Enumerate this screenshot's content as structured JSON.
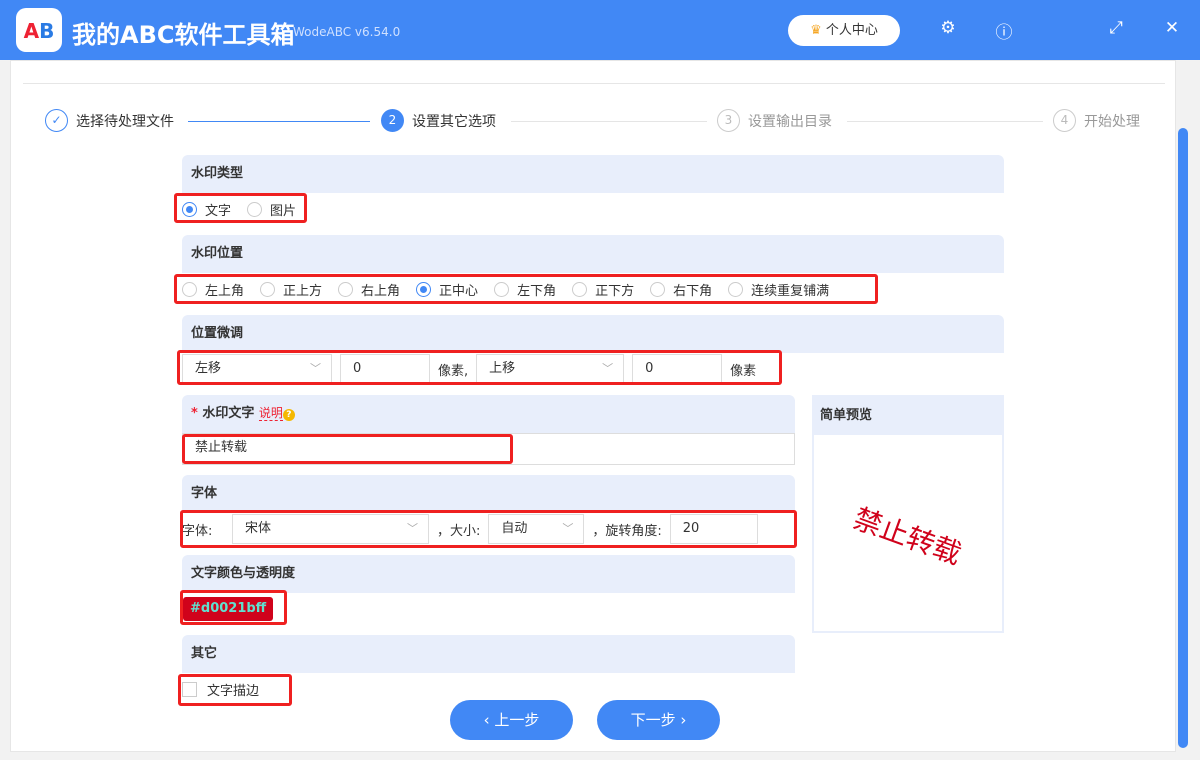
{
  "app": {
    "title": "我的ABC软件工具箱",
    "version": "WodeABC v6.54.0",
    "logo_text": "AB",
    "user_center": "个人中心"
  },
  "steps": [
    {
      "num": "✓",
      "label": "选择待处理文件"
    },
    {
      "num": "2",
      "label": "设置其它选项"
    },
    {
      "num": "3",
      "label": "设置输出目录"
    },
    {
      "num": "4",
      "label": "开始处理"
    }
  ],
  "watermark_type": {
    "title": "水印类型",
    "options": [
      "文字",
      "图片"
    ],
    "selected": "文字"
  },
  "watermark_position": {
    "title": "水印位置",
    "options": [
      "左上角",
      "正上方",
      "右上角",
      "正中心",
      "左下角",
      "正下方",
      "右下角",
      "连续重复铺满"
    ],
    "selected": "正中心"
  },
  "position_adjust": {
    "title": "位置微调",
    "h_dir": "左移",
    "h_value": "0",
    "h_unit": "像素,",
    "v_dir": "上移",
    "v_value": "0",
    "v_unit": "像素"
  },
  "watermark_text": {
    "title": "水印文字",
    "required": "*",
    "help": "说明",
    "value": "禁止转载"
  },
  "font": {
    "title": "字体",
    "font_label": "字体:",
    "font_value": "宋体",
    "size_label": "，大小:",
    "size_value": "自动",
    "rotate_label": "，旋转角度:",
    "rotate_value": "20"
  },
  "color": {
    "title": "文字颜色与透明度",
    "value": "#d0021bff",
    "swatch": "#d0021b"
  },
  "other": {
    "title": "其它",
    "stroke_label": "文字描边"
  },
  "preview": {
    "title": "简单预览",
    "text": "禁止转载"
  },
  "nav": {
    "prev": "上一步",
    "next": "下一步"
  }
}
